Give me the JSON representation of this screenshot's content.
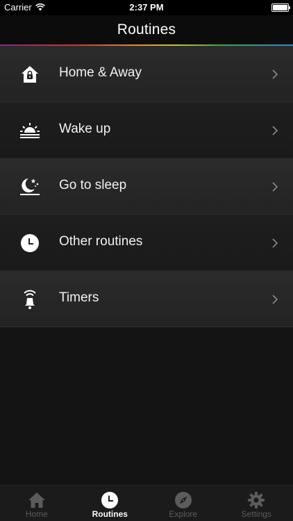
{
  "status_bar": {
    "carrier": "Carrier",
    "time": "2:37 PM"
  },
  "nav": {
    "title": "Routines"
  },
  "routines": [
    {
      "label": "Home & Away",
      "icon": "home-lock-icon"
    },
    {
      "label": "Wake up",
      "icon": "sunrise-icon"
    },
    {
      "label": "Go to sleep",
      "icon": "moon-stars-icon"
    },
    {
      "label": "Other routines",
      "icon": "clock-icon"
    },
    {
      "label": "Timers",
      "icon": "bell-alarm-icon"
    }
  ],
  "tabs": [
    {
      "label": "Home",
      "icon": "house-icon",
      "active": false
    },
    {
      "label": "Routines",
      "icon": "clock-icon",
      "active": true
    },
    {
      "label": "Explore",
      "icon": "compass-icon",
      "active": false
    },
    {
      "label": "Settings",
      "icon": "gear-icon",
      "active": false
    }
  ],
  "colors": {
    "background": "#141414",
    "tab_inactive": "#5c5c5c",
    "tab_active": "#ffffff"
  }
}
